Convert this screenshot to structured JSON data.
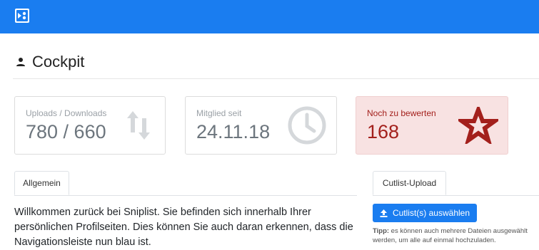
{
  "colors": {
    "brand": "#1a7df0",
    "alert_bg": "#f8e2e2",
    "alert_text": "#a3201c"
  },
  "header": {
    "logo_icon": "sniplist-logo-icon"
  },
  "page": {
    "title": "Cockpit",
    "title_icon": "user-icon"
  },
  "stats": [
    {
      "label": "Uploads / Downloads",
      "value": "780 / 660",
      "icon": "up-down-arrows-icon"
    },
    {
      "label": "Mitglied seit",
      "value": "24.11.18",
      "icon": "clock-icon"
    },
    {
      "label": "Noch zu bewerten",
      "value": "168",
      "icon": "star-icon"
    }
  ],
  "general": {
    "tab_label": "Allgemein",
    "welcome_text": "Willkommen zurück bei Sniplist. Sie befinden sich innerhalb Ihrer persönlichen Profilseiten. Dies können Sie auch daran erkennen, dass die Navigationsleiste nun blau ist."
  },
  "upload": {
    "tab_label": "Cutlist-Upload",
    "button_label": "Cutlist(s) auswählen",
    "tip_label": "Tipp:",
    "tip_text": " es können auch mehrere Dateien ausgewählt werden, um alle auf einmal hochzuladen."
  }
}
